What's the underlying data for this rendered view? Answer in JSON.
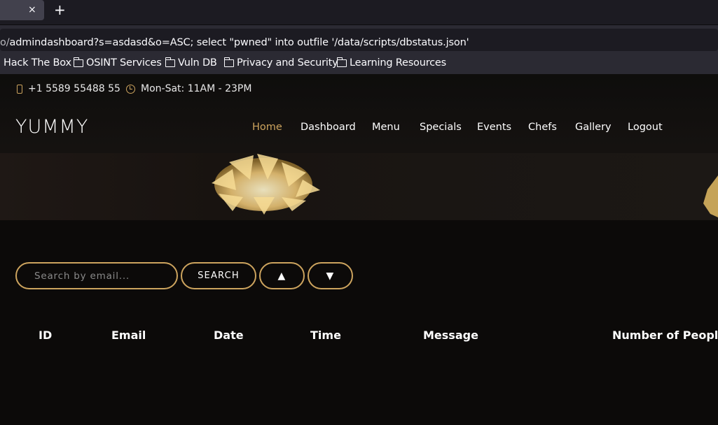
{
  "browser": {
    "tab_close": "×",
    "new_tab": "+",
    "url_prefix": "o/",
    "url_rest": "admindashboard?s=asdasd&o=ASC; select \"pwned\" into outfile '/data/scripts/dbstatus.json'",
    "bookmarks": [
      {
        "label": "Hack The Box",
        "icon": "none"
      },
      {
        "label": "OSINT Services",
        "icon": "folder-icon"
      },
      {
        "label": "Vuln DB",
        "icon": "folder-icon"
      },
      {
        "label": "Privacy and Security",
        "icon": "folder-icon"
      },
      {
        "label": "Learning Resources",
        "icon": "folder-icon"
      }
    ]
  },
  "topbar": {
    "phone": "+1 5589 55488 55",
    "hours": "Mon-Sat: 11AM - 23PM"
  },
  "header": {
    "logo": "YUMMY",
    "nav": [
      "Home",
      "Dashboard",
      "Menu",
      "Specials",
      "Events",
      "Chefs",
      "Gallery",
      "Logout"
    ],
    "active": "Home"
  },
  "search": {
    "placeholder": "Search by email...",
    "button": "SEARCH",
    "sort_asc": "▲",
    "sort_desc": "▼"
  },
  "table": {
    "columns": [
      "ID",
      "Email",
      "Date",
      "Time",
      "Message",
      "Number of People"
    ]
  },
  "colors": {
    "accent": "#cda45e",
    "background": "#0c0a09"
  }
}
